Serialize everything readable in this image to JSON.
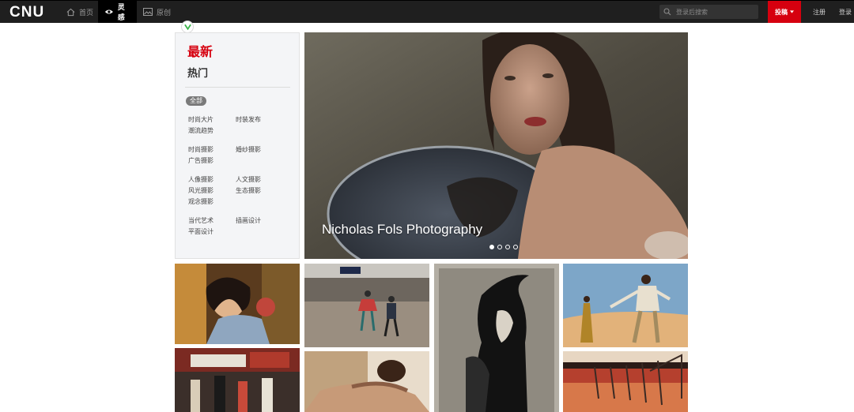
{
  "header": {
    "logo": "CNU",
    "nav": [
      {
        "label": "首页",
        "icon": "home-icon",
        "active": false
      },
      {
        "label": "灵感",
        "icon": "eye-icon",
        "active": true
      },
      {
        "label": "原创",
        "icon": "image-icon",
        "active": false
      }
    ],
    "search_placeholder": "登录后搜索",
    "submit_label": "投稿",
    "register_label": "注册",
    "login_label": "登录"
  },
  "sidebar": {
    "tab_latest": "最新",
    "tab_hot": "热门",
    "tag_all": "全部",
    "categories": [
      "时尚大片",
      "时装发布",
      "潮流趋势",
      "时尚摄影",
      "婚纱摄影",
      "广告摄影",
      "人像摄影",
      "人文摄影",
      "风光摄影",
      "生态摄影",
      "观念摄影",
      "当代艺术",
      "插画设计",
      "平面设计"
    ]
  },
  "hero": {
    "title": "Nicholas Fols Photography",
    "slide_count": 4,
    "active_slide": 1
  },
  "colors": {
    "accent": "#d6000f",
    "header_bg": "#1f1f1f"
  }
}
